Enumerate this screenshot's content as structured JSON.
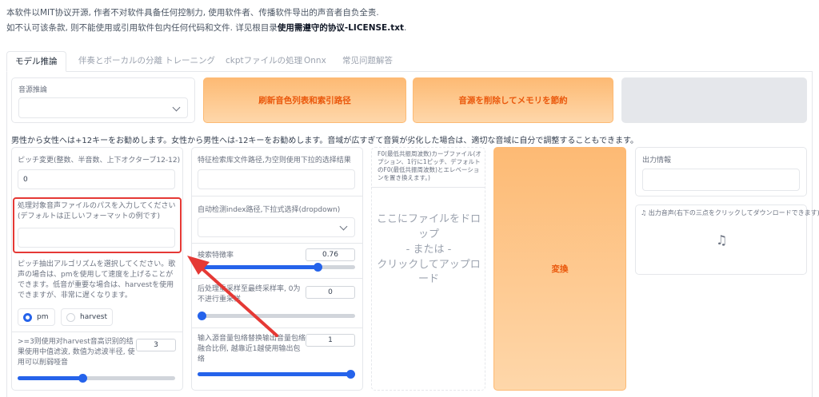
{
  "notice": {
    "line1": "本软件以MIT协议开源, 作者不对软件具备任何控制力, 使用软件者、传播软件导出的声音者自负全责.",
    "line2_prefix": "如不认可该条款, 则不能使用或引用软件包内任何代码和文件. 详见根目录",
    "line2_bold": "使用需遵守的协议-LICENSE.txt",
    "line2_suffix": "."
  },
  "tabs": [
    {
      "label": "モデル推論",
      "active": true
    },
    {
      "label": "伴奏とボーカルの分離",
      "active": false
    },
    {
      "label": "トレーニング",
      "active": false
    },
    {
      "label": "ckptファイルの処理",
      "active": false
    },
    {
      "label": "Onnx",
      "active": false
    },
    {
      "label": "常见问题解答",
      "active": false
    }
  ],
  "top": {
    "source_label": "音源推論",
    "source_value": "",
    "refresh_button": "刷新音色列表和索引路径",
    "unload_button": "音源を削除してメモリを節約"
  },
  "hint": "男性から女性へは+12キーをお勧めします。女性から男性へは-12キーをお勧めします。音域が広すぎて音質が劣化した場合は、適切な音域に自分で調整することもできます。",
  "col1": {
    "pitch_label": "ピッチ変更(整数、半音数、上下オクターブ12-12)",
    "pitch_value": "0",
    "path_label": "処理対象音声ファイルのパスを入力してください(デフォルトは正しいフォーマットの例です)",
    "path_value": "",
    "algo_label": "ピッチ抽出アルゴリズムを選択してください。歌声の場合は、pmを使用して速度を上げることができます。低音が重要な場合は、harvestを使用できますが、非常に遅くなります。",
    "algo_options": [
      "pm",
      "harvest"
    ],
    "algo_selected": "pm",
    "filter_label": ">=3则使用对harvest音高识别的结果使用中值滤波, 数值为滤波半径, 使用可以削弱哑音",
    "filter_value": "3",
    "filter_fraction": 0.41
  },
  "col2": {
    "index_path_label": "特征检索库文件路径,为空则使用下拉的选择结果",
    "index_path_value": "",
    "auto_index_label": "自动检测index路径,下拉式选择(dropdown)",
    "auto_index_value": "",
    "ratio_label": "検索特徴率",
    "ratio_value": "0.76",
    "ratio_fraction": 0.76,
    "resample_label": "后处理重采样至最终采样率, 0为不进行重采样",
    "resample_value": "0",
    "resample_fraction": 0,
    "envelope_label": "输入源音量包络替换输出音量包络融合比例, 越靠近1越使用输出包络",
    "envelope_value": "1",
    "envelope_fraction": 1
  },
  "col3": {
    "f0_label": "F0(最低共振周波数)カーブファイル(オプション、1行に1ピッチ、デフォルトのF0(最低共振周波数)とエレベーションを置き換えます。)",
    "drop_line1": "ここにファイルをドロップ",
    "drop_line2": "- または -",
    "drop_line3": "クリックしてアップロード"
  },
  "convert_button": "変換",
  "output": {
    "info_label": "出力情報",
    "info_value": "",
    "audio_label": "出力音声(右下の三点をクリックしてダウンロードできます)"
  },
  "colors": {
    "accent": "#2563eb",
    "orange_text": "#ea580c",
    "highlight": "#e53935"
  }
}
